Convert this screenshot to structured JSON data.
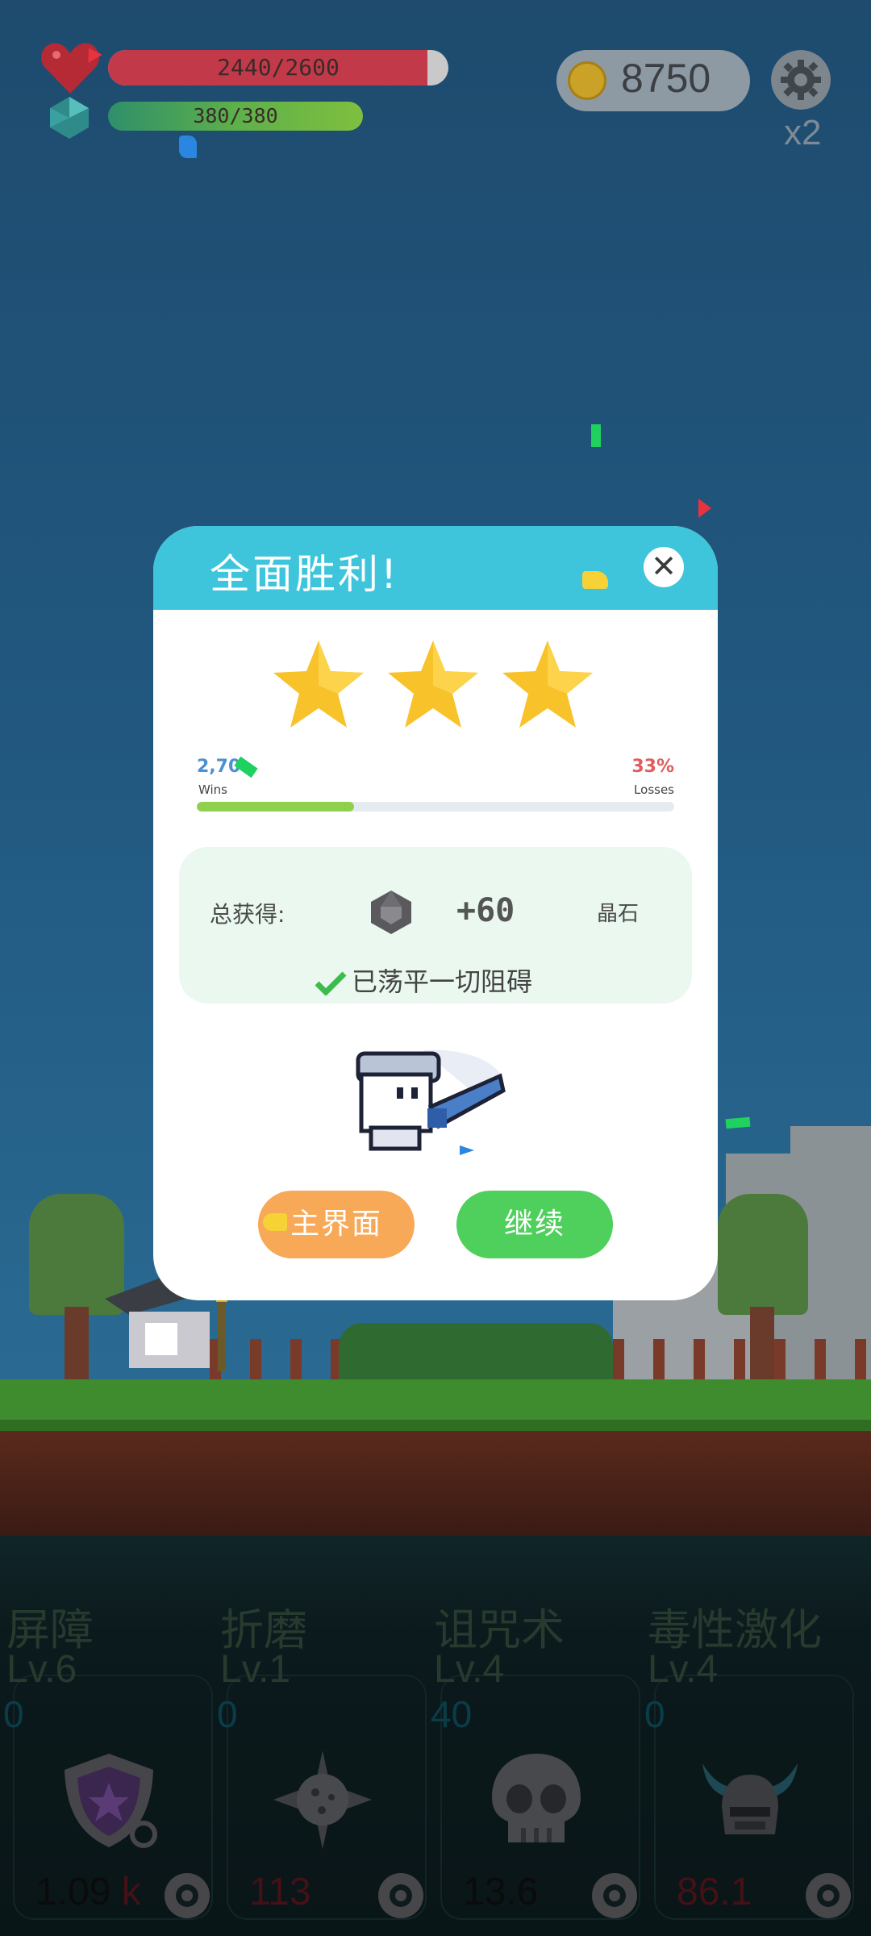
{
  "hud": {
    "hp_text": "2440/2600",
    "hp_fraction": 0.938,
    "mp_text": "380/380",
    "mp_fraction": 1.0,
    "coins": "8750",
    "speed": "x2",
    "colors": {
      "hp": "#c23a4a",
      "mp": "#4aa04a",
      "coin": "#c9a227"
    }
  },
  "dialog": {
    "title": "全面胜利!",
    "stars": 3,
    "wins_value": "2,70",
    "wins_label": "Wins",
    "losses_value": "33%",
    "losses_label": "Losses",
    "progress": 0.33,
    "reward_label": "总获得:",
    "reward_amount": "+60",
    "reward_unit": "晶石",
    "cleared_text": "已荡平一切阻碍",
    "main_button": "主界面",
    "continue_button": "继续",
    "icons": [
      "close-icon",
      "star-icon",
      "gem-icon",
      "check-icon"
    ]
  },
  "skills": [
    {
      "name": "屏障",
      "level": "Lv.6",
      "count": "0",
      "cost": "1.09",
      "cost_suffix": "k",
      "icon": "shield-icon"
    },
    {
      "name": "折磨",
      "level": "Lv.1",
      "count": "0",
      "cost": "113",
      "cost_suffix": "",
      "icon": "spiked-ball-icon"
    },
    {
      "name": "诅咒术",
      "level": "Lv.4",
      "count": "40",
      "cost": "13.6",
      "cost_suffix": "",
      "icon": "skull-icon"
    },
    {
      "name": "毒性激化",
      "level": "Lv.4",
      "count": "0",
      "cost": "86.1",
      "cost_suffix": "",
      "icon": "horned-helmet-icon"
    }
  ]
}
